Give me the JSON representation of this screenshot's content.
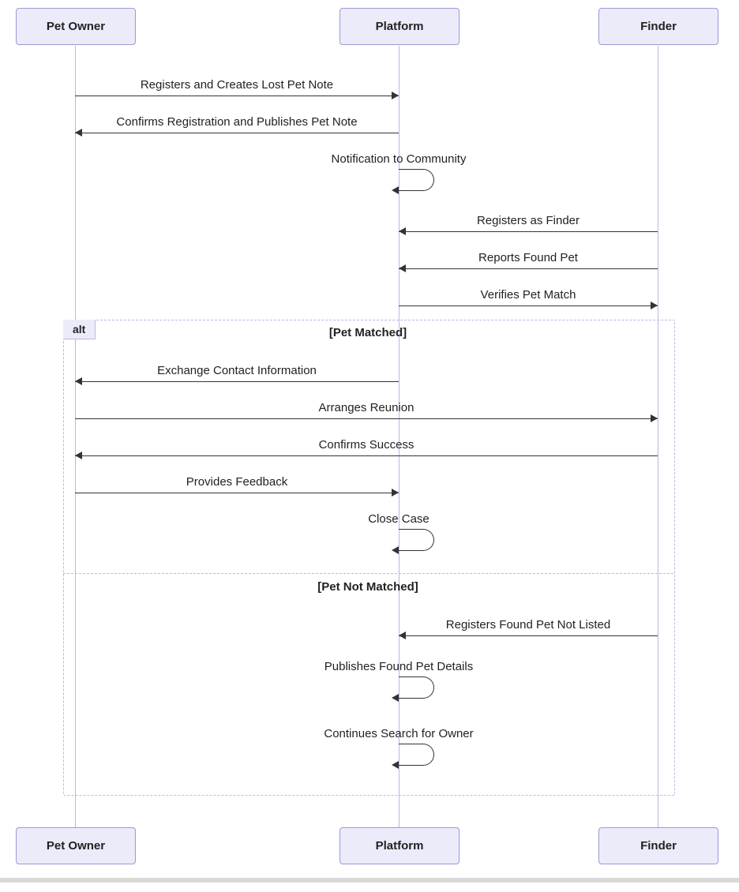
{
  "actors": {
    "owner": "Pet Owner",
    "platform": "Platform",
    "finder": "Finder"
  },
  "messages": {
    "m1": "Registers and Creates Lost Pet Note",
    "m2": "Confirms Registration and Publishes Pet Note",
    "m3": "Notification to Community",
    "m4": "Registers as Finder",
    "m5": "Reports Found Pet",
    "m6": "Verifies Pet Match",
    "m7": "Exchange Contact Information",
    "m8": "Arranges Reunion",
    "m9": "Confirms Success",
    "m10": "Provides Feedback",
    "m11": "Close Case",
    "m12": "Registers Found Pet Not Listed",
    "m13": "Publishes Found Pet Details",
    "m14": "Continues Search for Owner"
  },
  "alt": {
    "label": "alt",
    "cond1": "[Pet Matched]",
    "cond2": "[Pet Not Matched]"
  }
}
